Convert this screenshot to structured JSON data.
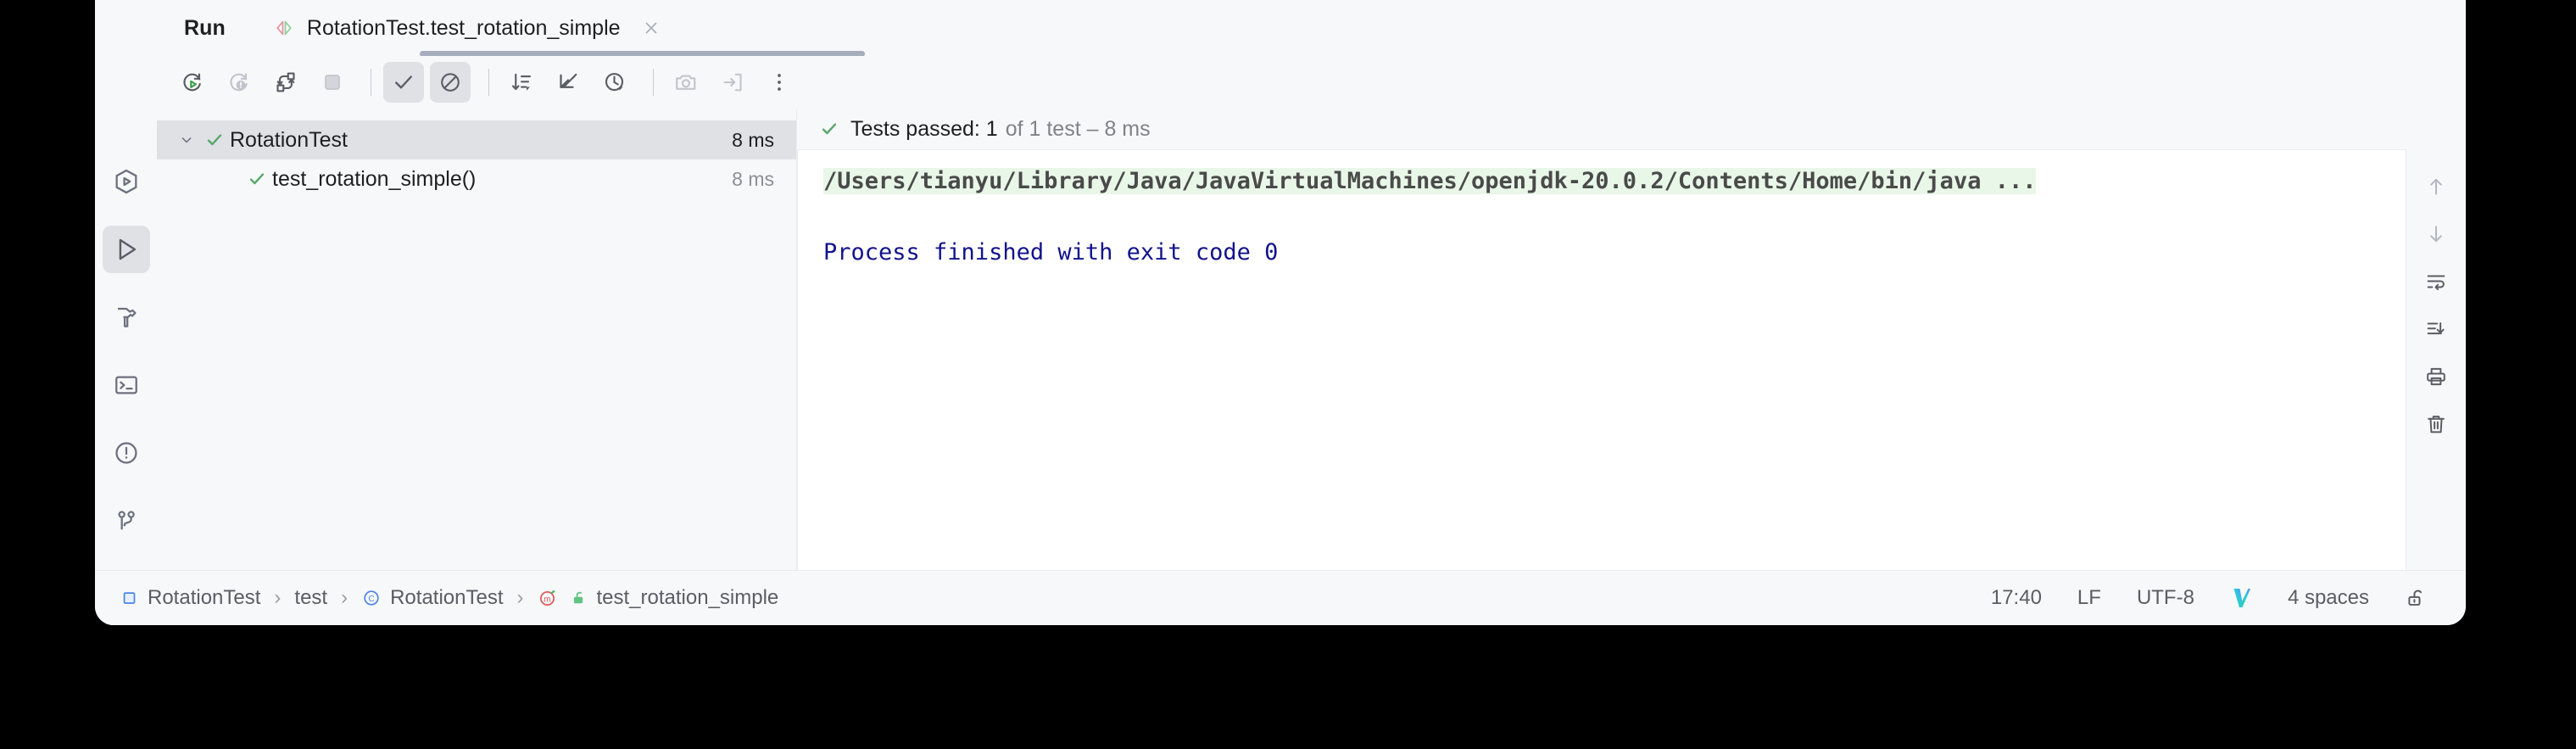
{
  "window": {
    "background": "#000000",
    "panel_bg": "#f7f8fa",
    "console_bg": "#ffffff"
  },
  "header": {
    "run_label": "Run",
    "tab": {
      "title": "RotationTest.test_rotation_simple",
      "icon": "run-configuration-icon",
      "close_icon": "close-icon"
    }
  },
  "toolbar": {
    "buttons": [
      {
        "name": "rerun-icon",
        "label": "Rerun",
        "state": "enabled"
      },
      {
        "name": "rerun-failed-tests-icon",
        "label": "Rerun Failed Tests",
        "state": "disabled"
      },
      {
        "name": "toggle-auto-test-icon",
        "label": "Toggle auto-test",
        "state": "enabled"
      },
      {
        "name": "stop-icon",
        "label": "Stop",
        "state": "disabled"
      },
      {
        "name": "show-passed-icon",
        "label": "Show Passed",
        "state": "active"
      },
      {
        "name": "show-ignored-icon",
        "label": "Show Ignored",
        "state": "active"
      },
      {
        "name": "sort-alphabetically-icon",
        "label": "Sort Alphabetically",
        "state": "enabled"
      },
      {
        "name": "expand-collapse-icon",
        "label": "Collapse All",
        "state": "enabled"
      },
      {
        "name": "test-history-icon",
        "label": "Test History",
        "state": "enabled"
      },
      {
        "name": "export-screenshot-icon",
        "label": "Export Test Results",
        "state": "disabled"
      },
      {
        "name": "import-tests-icon",
        "label": "Import Tests from File",
        "state": "disabled"
      },
      {
        "name": "more-options-icon",
        "label": "More Options",
        "state": "enabled"
      }
    ]
  },
  "sidebar": {
    "items": [
      {
        "name": "sidebar-item-services",
        "icon": "services-icon",
        "label": "Services",
        "selected": false
      },
      {
        "name": "sidebar-item-run",
        "icon": "run-icon",
        "label": "Run",
        "selected": true
      },
      {
        "name": "sidebar-item-build",
        "icon": "hammer-icon",
        "label": "Build",
        "selected": false
      },
      {
        "name": "sidebar-item-terminal",
        "icon": "terminal-icon",
        "label": "Terminal",
        "selected": false
      },
      {
        "name": "sidebar-item-problems",
        "icon": "warning-circle-icon",
        "label": "Problems",
        "selected": false
      },
      {
        "name": "sidebar-item-version-control",
        "icon": "git-branch-icon",
        "label": "Version Control",
        "selected": false
      }
    ]
  },
  "test_tree": {
    "rows": [
      {
        "name": "test-suite-row",
        "label": "RotationTest",
        "duration": "8 ms",
        "status": "passed",
        "expanded": true,
        "selected": true,
        "child": false
      },
      {
        "name": "test-case-row",
        "label": "test_rotation_simple()",
        "duration": "8 ms",
        "status": "passed",
        "expanded": false,
        "selected": false,
        "child": true
      }
    ]
  },
  "results": {
    "status_icon": "checkmark-icon",
    "passed_text": "Tests passed: 1",
    "detail_text": "of 1 test – 8 ms"
  },
  "console": {
    "command_line": "/Users/tianyu/Library/Java/JavaVirtualMachines/openjdk-20.0.2/Contents/Home/bin/java ...",
    "exit_line": "Process finished with exit code 0",
    "command_highlight": "#e9f7e9",
    "exit_color": "#12128c"
  },
  "console_gutter": {
    "buttons": [
      {
        "name": "scroll-up-icon",
        "label": "Up"
      },
      {
        "name": "scroll-down-icon",
        "label": "Down"
      },
      {
        "name": "soft-wrap-icon",
        "label": "Soft-Wrap"
      },
      {
        "name": "scroll-to-end-icon",
        "label": "Scroll to End"
      },
      {
        "name": "print-icon",
        "label": "Print"
      },
      {
        "name": "trash-icon",
        "label": "Clear All"
      }
    ]
  },
  "status_bar": {
    "breadcrumb": [
      {
        "name": "breadcrumb-module",
        "icon": "module-icon",
        "label": "RotationTest"
      },
      {
        "name": "breadcrumb-folder",
        "icon": "none",
        "label": "test"
      },
      {
        "name": "breadcrumb-class",
        "icon": "class-icon",
        "label": "RotationTest"
      },
      {
        "name": "breadcrumb-method",
        "icon": "method-icon",
        "label": "test_rotation_simple"
      }
    ],
    "separator": "›",
    "time": "17:40",
    "line_separator": "LF",
    "encoding": "UTF-8",
    "vcs_icon": "vcs-logo-icon",
    "indent": "4 spaces",
    "lock_icon": "unlock-icon"
  }
}
